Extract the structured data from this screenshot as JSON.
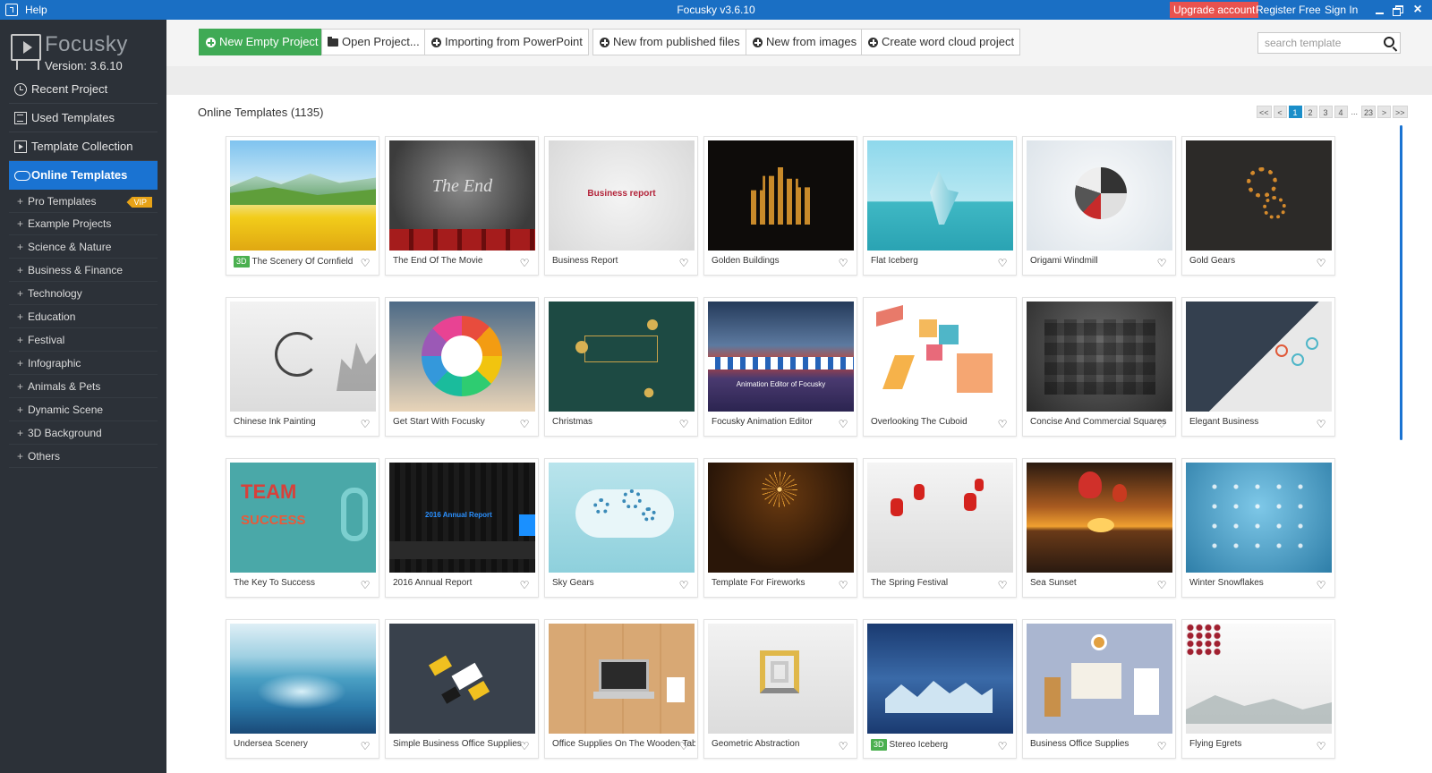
{
  "titlebar": {
    "help": "Help",
    "title": "Focusky v3.6.10",
    "upgrade": "Upgrade account",
    "register": "Register Free",
    "signin": "Sign In",
    "close": "×"
  },
  "sidebar": {
    "logo_name": "Focusky",
    "version": "Version: 3.6.10",
    "nav": [
      {
        "label": "Recent Project",
        "icon": "clock-icon"
      },
      {
        "label": "Used Templates",
        "icon": "list-icon"
      },
      {
        "label": "Template Collection",
        "icon": "monitor-icon"
      },
      {
        "label": "Online Templates",
        "icon": "cloud-icon"
      }
    ],
    "categories": [
      "Pro Templates",
      "Example Projects",
      "Science & Nature",
      "Business & Finance",
      "Technology",
      "Education",
      "Festival",
      "Infographic",
      "Animals & Pets",
      "Dynamic Scene",
      "3D Background",
      "Others"
    ],
    "vip": "VIP"
  },
  "toolbar": {
    "buttons": [
      "New Empty Project",
      "Open Project...",
      "Importing from PowerPoint",
      "New from published files",
      "New from images",
      "Create word cloud project"
    ],
    "search_placeholder": "search template"
  },
  "main": {
    "section_title": "Online Templates (1135)",
    "pager": [
      "<<",
      "<",
      "1",
      "2",
      "3",
      "4",
      "...",
      "23",
      ">",
      ">>"
    ],
    "current_page": "1",
    "heart": "♡",
    "badge_3d": "3D",
    "thumb_text": {
      "the_end": "The End",
      "business_report": "Business report",
      "annual": "2016 Annual Report",
      "team": "TEAM",
      "success": "SUCCESS",
      "animation": "Animation Editor of Focusky"
    },
    "templates": [
      {
        "title": "The Scenery Of Cornfield",
        "badge": true
      },
      {
        "title": "The End Of The Movie"
      },
      {
        "title": "Business Report"
      },
      {
        "title": "Golden Buildings"
      },
      {
        "title": "Flat Iceberg"
      },
      {
        "title": "Origami Windmill"
      },
      {
        "title": "Gold Gears"
      },
      {
        "title": "Chinese Ink Painting"
      },
      {
        "title": "Get Start With Focusky"
      },
      {
        "title": "Christmas"
      },
      {
        "title": "Focusky Animation Editor"
      },
      {
        "title": "Overlooking The Cuboid"
      },
      {
        "title": "Concise And Commercial Squares"
      },
      {
        "title": "Elegant Business"
      },
      {
        "title": "The Key To Success"
      },
      {
        "title": "2016 Annual Report"
      },
      {
        "title": "Sky Gears"
      },
      {
        "title": "Template For Fireworks"
      },
      {
        "title": "The Spring Festival"
      },
      {
        "title": "Sea Sunset"
      },
      {
        "title": "Winter Snowflakes"
      },
      {
        "title": "Undersea Scenery"
      },
      {
        "title": "Simple Business Office Supplies"
      },
      {
        "title": "Office Supplies On The Wooden Tab"
      },
      {
        "title": "Geometric Abstraction"
      },
      {
        "title": "Stereo Iceberg",
        "badge": true
      },
      {
        "title": "Business Office Supplies"
      },
      {
        "title": "Flying Egrets"
      }
    ]
  }
}
